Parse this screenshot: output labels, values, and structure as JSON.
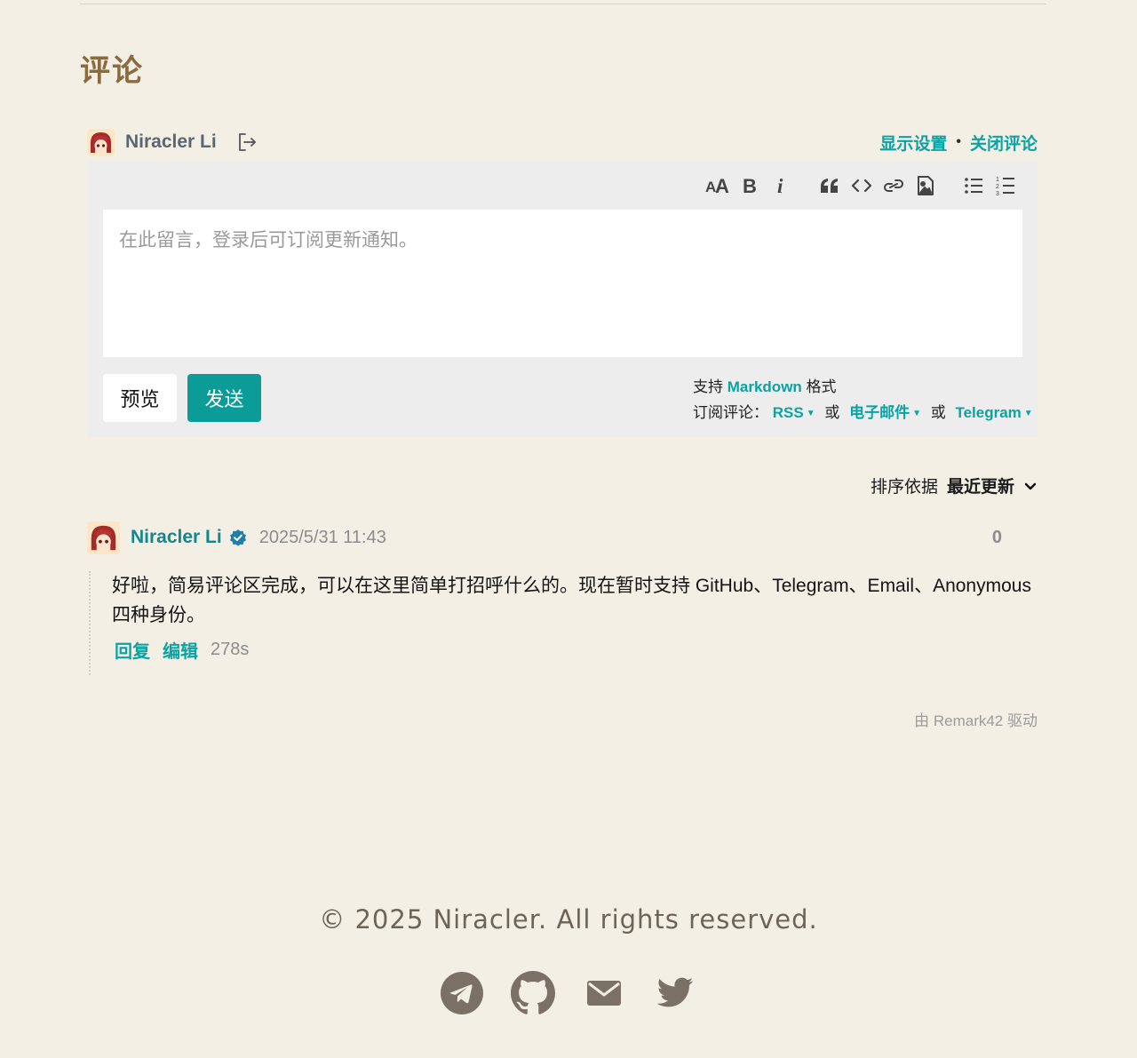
{
  "section": {
    "title": "评论"
  },
  "user": {
    "name": "Niracler Li"
  },
  "header_links": {
    "display_settings": "显示设置",
    "separator": "•",
    "close_comments": "关闭评论"
  },
  "editor": {
    "placeholder": "在此留言，登录后可订阅更新通知。",
    "value": "",
    "toolbar": [
      "heading-icon",
      "bold-icon",
      "italic-icon",
      "quote-icon",
      "code-icon",
      "link-icon",
      "image-icon",
      "unordered-list-icon",
      "ordered-list-icon"
    ],
    "preview_label": "预览",
    "send_label": "发送",
    "markdown_prefix": "支持",
    "markdown_link": "Markdown",
    "markdown_suffix": "格式",
    "subscribe_label": "订阅评论：",
    "sub_rss": "RSS",
    "sub_or": "或",
    "sub_email": "电子邮件",
    "sub_telegram": "Telegram"
  },
  "sort": {
    "label": "排序依据",
    "value": "最近更新"
  },
  "comments": [
    {
      "author": "Niracler Li",
      "time": "2025/5/31 11:43",
      "score": "0",
      "text": "好啦，简易评论区完成，可以在这里简单打招呼什么的。现在暂时支持 GitHub、Telegram、Email、Anonymous 四种身份。",
      "reply_label": "回复",
      "edit_label": "编辑",
      "elapsed": "278s"
    }
  ],
  "powered_by": "由 Remark42 驱动",
  "footer": {
    "copyright": "© 2025 Niracler. All rights reserved.",
    "social": [
      "telegram-icon",
      "github-icon",
      "email-icon",
      "twitter-icon"
    ]
  },
  "colors": {
    "accent": "#0aa3a3",
    "send_button": "#0c9c97",
    "title": "#8b6a3e",
    "background": "#f4efe5"
  }
}
